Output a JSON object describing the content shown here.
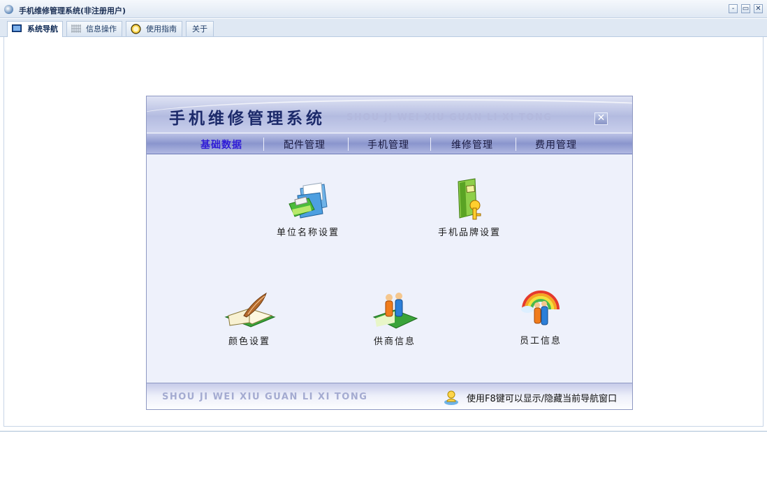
{
  "window": {
    "title": "手机维修管理系统(非注册用户)",
    "controls": {
      "minimize": "-",
      "restore": "▭",
      "close": "✕"
    }
  },
  "tabs": [
    {
      "label": "系统导航",
      "icon": "monitor-icon",
      "active": true
    },
    {
      "label": "信息操作",
      "icon": "grid-icon",
      "active": false
    },
    {
      "label": "使用指南",
      "icon": "clock-icon",
      "active": false
    },
    {
      "label": "关于",
      "icon": "",
      "active": false
    }
  ],
  "panel": {
    "title": "手机维修管理系统",
    "subtitle": "SHOU JI WEI XIU GUAN LI XI TONG",
    "close_symbol": "✕",
    "nav": [
      {
        "label": "基础数据",
        "active": true
      },
      {
        "label": "配件管理",
        "active": false
      },
      {
        "label": "手机管理",
        "active": false
      },
      {
        "label": "维修管理",
        "active": false
      },
      {
        "label": "费用管理",
        "active": false
      }
    ],
    "items": [
      {
        "label": "单位名称设置",
        "icon": "folder-printer-icon"
      },
      {
        "label": "手机品牌设置",
        "icon": "book-key-icon"
      },
      {
        "label": "颜色设置",
        "icon": "book-quill-icon"
      },
      {
        "label": "供商信息",
        "icon": "people-book-icon"
      },
      {
        "label": "员工信息",
        "icon": "people-rainbow-icon"
      }
    ],
    "footer": {
      "subtitle": "SHOU JI WEI XIU GUAN LI XI TONG",
      "tip": "使用F8键可以显示/隐藏当前导航窗口",
      "tip_icon": "user-tip-icon"
    }
  },
  "colors": {
    "nav_active": "#2f1cd6",
    "panel_bg": "#eef1fb",
    "header_blue": "#b3bbe0"
  }
}
